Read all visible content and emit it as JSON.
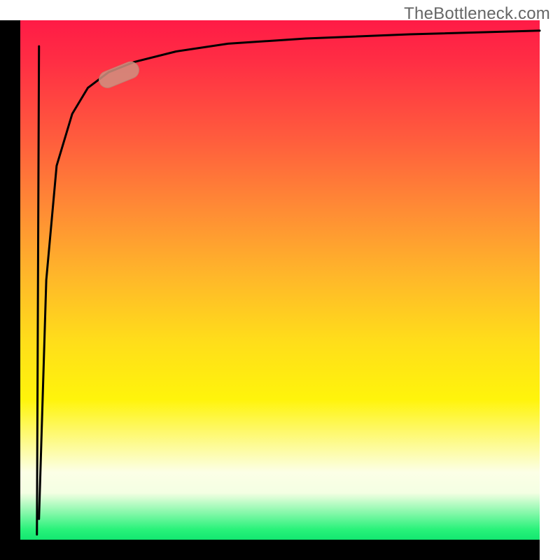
{
  "branding": {
    "label": "TheBottleneck.com"
  },
  "colors": {
    "axis": "#000000",
    "curve": "#000000",
    "marker_fill": "#d09080",
    "marker_stroke": "#c08272"
  },
  "chart_data": {
    "type": "line",
    "title": "",
    "xlabel": "",
    "ylabel": "",
    "xlim": [
      0,
      100
    ],
    "ylim": [
      0,
      100
    ],
    "notes": "No tick labels or numeric annotations are rendered in the image; curve values are pixel-estimated. Gradient fill runs top=red (bad) to bottom=green (good). X axis runs left→right 0–100, Y axis runs bottom→top 0–100.",
    "series": [
      {
        "name": "spike",
        "description": "Near-vertical spike just right of origin going from ≈0 at bottom to ≈95 near top.",
        "x": [
          3.2,
          3.6
        ],
        "y": [
          1.0,
          95.0
        ]
      },
      {
        "name": "main-curve",
        "description": "Logarithmic-style curve rising sharply then flattening asymptotically toward ≈98.",
        "x": [
          3.6,
          5,
          7,
          10,
          13,
          17,
          22,
          30,
          40,
          55,
          75,
          100
        ],
        "y": [
          4.0,
          50,
          72,
          82,
          87,
          90,
          92,
          94,
          95.5,
          96.5,
          97.3,
          98
        ]
      }
    ],
    "marker": {
      "description": "Rounded pill-shaped highlight on the curve near its knee.",
      "cx": 19.0,
      "cy": 89.5,
      "width": 8.0,
      "height": 3.2,
      "angle_deg": -22
    }
  }
}
